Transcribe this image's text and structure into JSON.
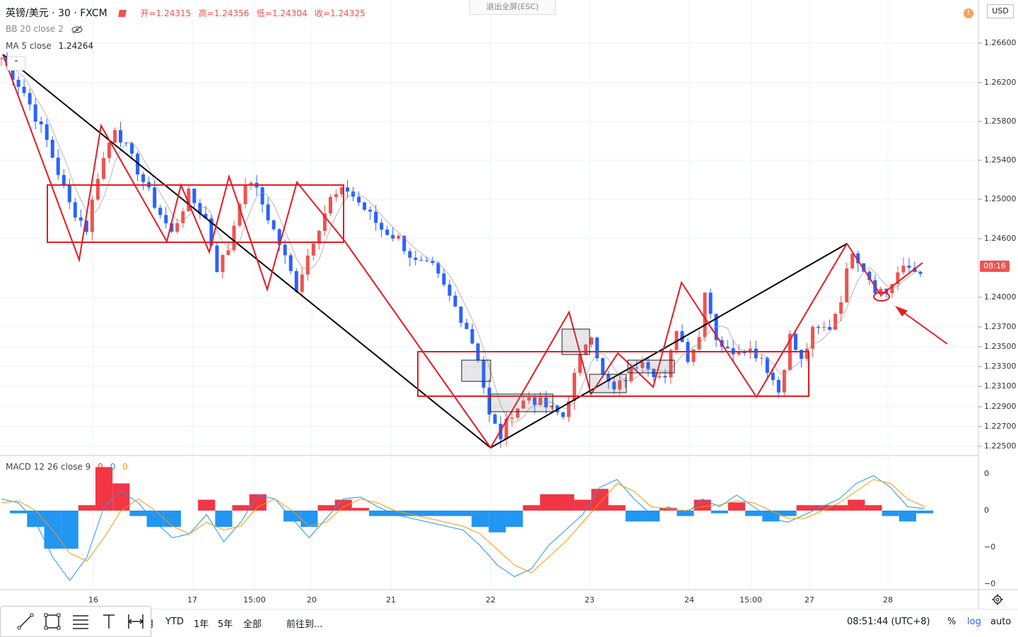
{
  "header": {
    "symbol": "英镑/美元 · 30 · FXCM",
    "open": "开=1.24315",
    "high": "高=1.24356",
    "low": "低=1.24304",
    "close": "收=1.24325"
  },
  "indicators": {
    "bb": "BB 20 close 2",
    "bb_icon": "eye-off-icon",
    "ma": "MA 5 close",
    "ma_value": "1.24264",
    "macd": "MACD 12 26 close 9",
    "macd_v1": "0",
    "macd_v2": "0",
    "macd_v3": "0"
  },
  "exit_fullscreen": "退出全屏(ESC)",
  "collapse_glyph": "⌃",
  "currency": "USD",
  "alert_badge": "!",
  "price_countdown": "08:16",
  "macd_axis": [
    "0",
    "0",
    "−0",
    "−0"
  ],
  "bottom": {
    "partial_label": "月",
    "ranges": [
      "YTD",
      "1年",
      "5年",
      "全部"
    ],
    "goto": "前往到...",
    "clock": "08:51:44 (UTC+8)",
    "percent": "%",
    "log": "log",
    "auto": "auto",
    "tools": [
      "trend-line-icon",
      "rectangle-icon",
      "fib-icon",
      "text-icon",
      "measure-icon"
    ]
  },
  "colors": {
    "up": "#ef5350",
    "down": "#2962ff",
    "drawing_red": "#e31b23",
    "drawing_black": "#000000",
    "macd_line": "#2196f3",
    "signal_line": "#ff9800",
    "hist_pos": "#f23645",
    "hist_neg": "#2196f3"
  },
  "chart_data": {
    "type": "candlestick",
    "y_ticks": [
      "1.26600",
      "1.26200",
      "1.25800",
      "1.25400",
      "1.25000",
      "1.24600",
      "1.24000",
      "1.23700",
      "1.23500",
      "1.23300",
      "1.23100",
      "1.22900",
      "1.22700",
      "1.22500"
    ],
    "x_ticks": [
      "16",
      "17",
      "15:00",
      "20",
      "21",
      "22",
      "23",
      "24",
      "15:00",
      "27",
      "28"
    ],
    "path": [
      [
        0,
        1.2645
      ],
      [
        4,
        1.261
      ],
      [
        8,
        1.256
      ],
      [
        12,
        1.2495
      ],
      [
        15,
        1.247
      ],
      [
        17,
        1.2525
      ],
      [
        20,
        1.2575
      ],
      [
        24,
        1.253
      ],
      [
        27,
        1.2495
      ],
      [
        30,
        1.2465
      ],
      [
        33,
        1.2505
      ],
      [
        36,
        1.248
      ],
      [
        38,
        1.243
      ],
      [
        40,
        1.245
      ],
      [
        42,
        1.25
      ],
      [
        44,
        1.252
      ],
      [
        46,
        1.2495
      ],
      [
        49,
        1.2455
      ],
      [
        52,
        1.241
      ],
      [
        55,
        1.246
      ],
      [
        58,
        1.25
      ],
      [
        61,
        1.251
      ],
      [
        64,
        1.249
      ],
      [
        67,
        1.247
      ],
      [
        70,
        1.246
      ],
      [
        73,
        1.2435
      ],
      [
        76,
        1.243
      ],
      [
        79,
        1.24
      ],
      [
        82,
        1.237
      ],
      [
        84,
        1.234
      ],
      [
        86,
        1.228
      ],
      [
        88,
        1.226
      ],
      [
        90,
        1.2285
      ],
      [
        93,
        1.23
      ],
      [
        96,
        1.229
      ],
      [
        99,
        1.228
      ],
      [
        101,
        1.232
      ],
      [
        103,
        1.2355
      ],
      [
        104,
        1.2365
      ],
      [
        106,
        1.232
      ],
      [
        108,
        1.2305
      ],
      [
        111,
        1.2325
      ],
      [
        113,
        1.234
      ],
      [
        115,
        1.2325
      ],
      [
        117,
        1.2315
      ],
      [
        119,
        1.237
      ],
      [
        121,
        1.234
      ],
      [
        123,
        1.236
      ],
      [
        124,
        1.241
      ],
      [
        126,
        1.236
      ],
      [
        128,
        1.2345
      ],
      [
        131,
        1.235
      ],
      [
        134,
        1.234
      ],
      [
        137,
        1.2305
      ],
      [
        139,
        1.236
      ],
      [
        141,
        1.2335
      ],
      [
        143,
        1.2365
      ],
      [
        146,
        1.237
      ],
      [
        148,
        1.24
      ],
      [
        150,
        1.245
      ],
      [
        152,
        1.243
      ],
      [
        154,
        1.241
      ],
      [
        156,
        1.2405
      ],
      [
        158,
        1.2425
      ],
      [
        160,
        1.243
      ],
      [
        162,
        1.2424
      ]
    ],
    "macd": [
      0.3,
      0.2,
      -0.3,
      -1.2,
      -1.8,
      -1.2,
      0.1,
      0.5,
      0.2,
      -0.3,
      -0.7,
      -0.6,
      -0.1,
      -0.8,
      -0.3,
      0.4,
      0.3,
      -0.2,
      -0.7,
      -0.2,
      0.3,
      0.35,
      0.1,
      -0.1,
      -0.2,
      -0.3,
      -0.4,
      -0.5,
      -0.9,
      -1.4,
      -1.7,
      -1.5,
      -0.9,
      -0.5,
      -0.1,
      0.6,
      0.8,
      0.3,
      -0.1,
      0.1,
      -0.1,
      0.3,
      0.1,
      0.4,
      0.1,
      -0.2,
      -0.3,
      -0.1,
      0.1,
      0.3,
      0.7,
      0.9,
      0.6,
      0.1,
      0.05
    ],
    "signal": [
      0.2,
      0.25,
      0.0,
      -0.5,
      -1.1,
      -1.3,
      -0.7,
      0.0,
      0.3,
      0.0,
      -0.4,
      -0.6,
      -0.3,
      -0.5,
      -0.4,
      0.1,
      0.3,
      0.0,
      -0.4,
      -0.3,
      0.1,
      0.3,
      0.2,
      0.0,
      -0.1,
      -0.2,
      -0.3,
      -0.4,
      -0.6,
      -1.0,
      -1.4,
      -1.6,
      -1.2,
      -0.8,
      -0.3,
      0.2,
      0.7,
      0.5,
      0.1,
      0.05,
      0.0,
      0.1,
      0.15,
      0.25,
      0.2,
      0.0,
      -0.2,
      -0.2,
      0.0,
      0.2,
      0.5,
      0.8,
      0.7,
      0.3,
      0.1
    ]
  }
}
